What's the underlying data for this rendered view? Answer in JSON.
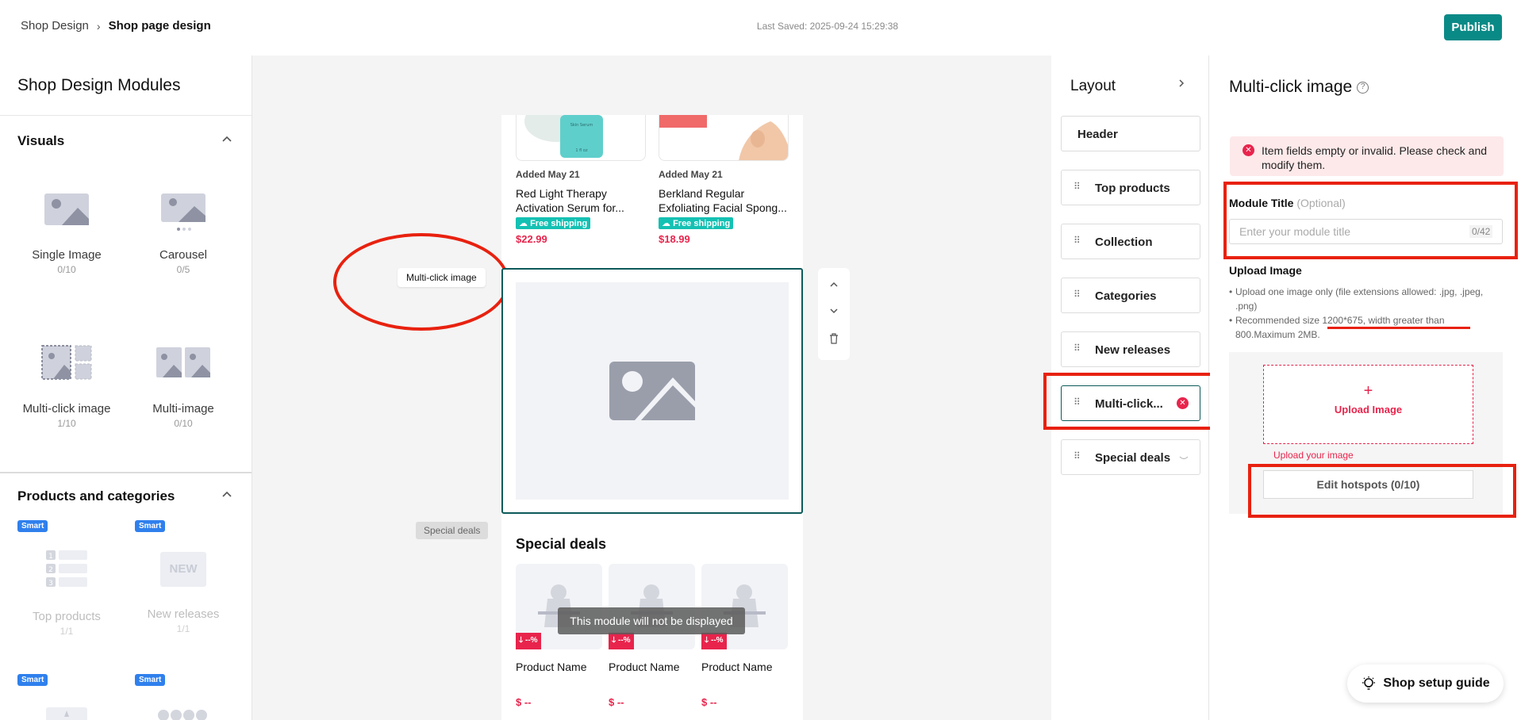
{
  "breadcrumb": {
    "parent": "Shop Design",
    "separator": "›",
    "current": "Shop page design"
  },
  "last_saved": "Last Saved: 2025-09-24 15:29:38",
  "publish_label": "Publish",
  "left_panel": {
    "title": "Shop Design Modules",
    "sections": {
      "visuals": {
        "title": "Visuals"
      },
      "products": {
        "title": "Products and categories"
      }
    },
    "modules": {
      "single_image": {
        "name": "Single Image",
        "count": "0/10"
      },
      "carousel": {
        "name": "Carousel",
        "count": "0/5"
      },
      "multi_click": {
        "name": "Multi-click image",
        "count": "1/10"
      },
      "multi_image": {
        "name": "Multi-image",
        "count": "0/10"
      },
      "top_products": {
        "name": "Top products",
        "count": "1/1",
        "badge": "Smart"
      },
      "new_releases": {
        "name": "New releases",
        "count": "1/1",
        "badge": "Smart",
        "thumb_text": "NEW"
      },
      "smart3": {
        "badge": "Smart"
      },
      "smart4": {
        "badge": "Smart"
      }
    }
  },
  "canvas": {
    "products": [
      {
        "added": "Added May 21",
        "name": "Red Light Therapy Activation Serum for...",
        "shipping": "Free shipping",
        "price": "$22.99"
      },
      {
        "added": "Added May 21",
        "name": "Berkland Regular Exfoliating Facial Spong...",
        "shipping": "Free shipping",
        "price": "$18.99"
      }
    ],
    "mc_label": "Multi-click image",
    "special_label": "Special deals",
    "special_title": "Special deals",
    "special_items": [
      {
        "badge": "--%",
        "name": "Product Name",
        "price": "$ --"
      },
      {
        "badge": "--%",
        "name": "Product Name",
        "price": "$ --"
      },
      {
        "badge": "--%",
        "name": "Product Name",
        "price": "$ --"
      }
    ],
    "not_displayed": "This module will not be displayed"
  },
  "layout_panel": {
    "title": "Layout",
    "items": [
      "Header",
      "Top products",
      "Collection",
      "Categories",
      "New releases",
      "Multi-click...",
      "Special deals"
    ]
  },
  "right_panel": {
    "title": "Multi-click image",
    "error": "Item fields empty or invalid. Please check and modify them.",
    "module_title_label": "Module Title",
    "module_title_optional": "(Optional)",
    "module_title_placeholder": "Enter your module title",
    "module_title_value": "",
    "module_title_counter": "0/42",
    "upload_title": "Upload Image",
    "rules": [
      "Upload one image only (file extensions allowed: .jpg, .jpeg, .png)",
      "Recommended size 1200*675, width greater than 800.Maximum 2MB."
    ],
    "upload_plus": "+",
    "upload_label": "Upload Image",
    "upload_hint": "Upload your image",
    "hotspots_label": "Edit hotspots (0/10)"
  },
  "guide_label": "Shop setup guide",
  "colors": {
    "accent": "#0a8a86",
    "error": "#e8244c",
    "annotation": "#e8210f",
    "selection": "#0d5a5a"
  }
}
